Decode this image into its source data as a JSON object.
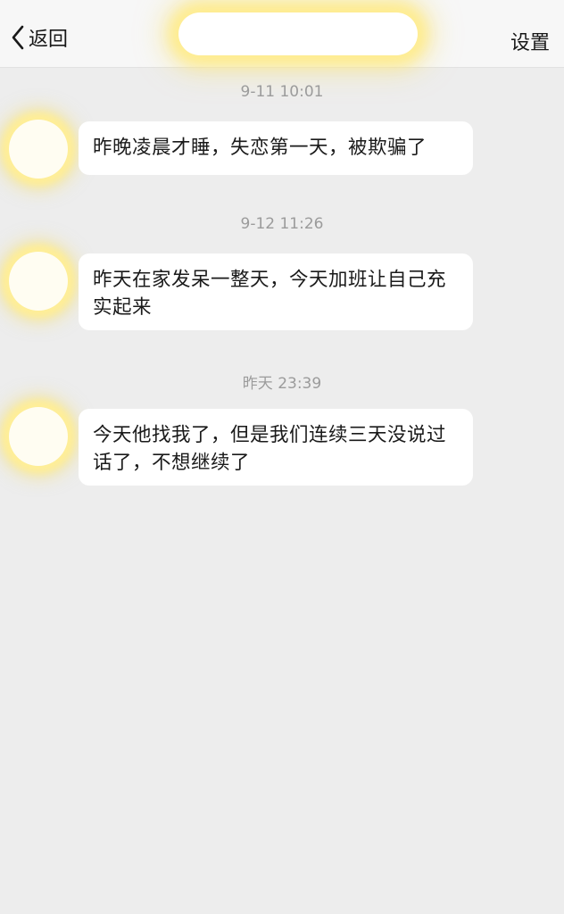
{
  "navbar": {
    "back_label": "返回",
    "settings_label": "设置"
  },
  "messages": [
    {
      "time": "9-11 10:01",
      "text": "昨晚凌晨才睡，失恋第一天，被欺骗了"
    },
    {
      "time": "9-12 11:26",
      "text": "昨天在家发呆一整天，今天加班让自己充实起来"
    },
    {
      "time": "昨天 23:39",
      "text": "今天他找我了，但是我们连续三天没说过话了，不想继续了"
    }
  ]
}
